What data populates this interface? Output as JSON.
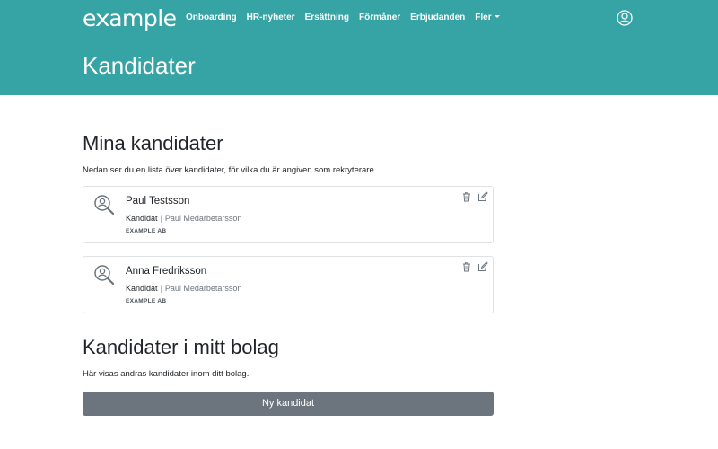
{
  "brand": {
    "logo_prefix": "e",
    "logo_x": "x",
    "logo_suffix": "ample"
  },
  "nav": {
    "items": [
      {
        "label": "Onboarding"
      },
      {
        "label": "HR-nyheter"
      },
      {
        "label": "Ersättning"
      },
      {
        "label": "Förmåner"
      },
      {
        "label": "Erbjudanden"
      },
      {
        "label": "Fler"
      }
    ],
    "user_icon": "user-circle-icon"
  },
  "header": {
    "title": "Kandidater"
  },
  "my_candidates": {
    "title": "Mina kandidater",
    "description": "Nedan ser du en lista över kandidater, för vilka du är angiven som rekryterare.",
    "items": [
      {
        "name": "Paul Testsson",
        "role": "Kandidat",
        "separator": "|",
        "manager": "Paul Medarbetarsson",
        "company": "EXAMPLE AB"
      },
      {
        "name": "Anna Fredriksson",
        "role": "Kandidat",
        "separator": "|",
        "manager": "Paul Medarbetarsson",
        "company": "EXAMPLE AB"
      }
    ]
  },
  "company_candidates": {
    "title": "Kandidater i mitt bolag",
    "description": "Här visas andras kandidater inom ditt bolag.",
    "button_label": "Ny kandidat"
  },
  "colors": {
    "header_bg": "#36a3a5",
    "button_bg": "#6c757d",
    "card_border": "#dfe2e5"
  }
}
